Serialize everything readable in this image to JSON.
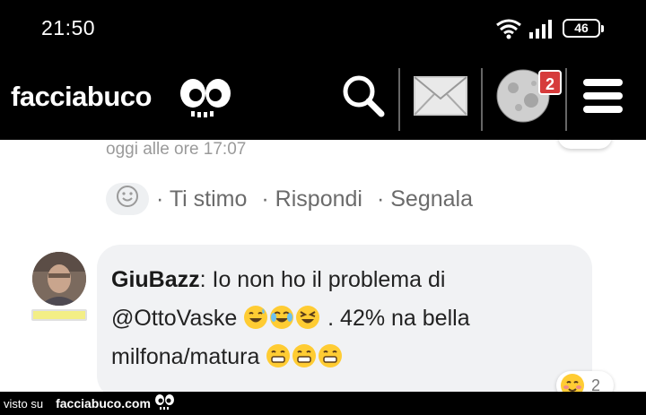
{
  "status_bar": {
    "time": "21:50",
    "battery": "46",
    "icons": [
      "wifi-icon",
      "signal-icon",
      "battery-icon"
    ]
  },
  "header": {
    "brand": "facciabuco",
    "notification_count": "2",
    "icons": [
      "search-icon",
      "mail-icon",
      "moon-avatar-icon",
      "menu-icon"
    ]
  },
  "comment_prev": {
    "timestamp": "oggi alle ore 17:07",
    "actions": [
      "· Ti stimo",
      "· Rispondi",
      "· Segnala"
    ]
  },
  "comment": {
    "author": "GiuBazz",
    "line1": ": Io non ho il problema di",
    "mention": "@OttoVaske",
    "line2_rest": " . 42% na bella",
    "line3": "milfona/matura ",
    "reaction_count": "2"
  },
  "footer": {
    "seen_on": "visto su",
    "site": "facciabuco.com"
  },
  "colors": {
    "header_bg": "#000000",
    "badge": "#d63b3b",
    "bubble_bg": "#f1f2f4",
    "rank_bar": "#f3ee86"
  }
}
